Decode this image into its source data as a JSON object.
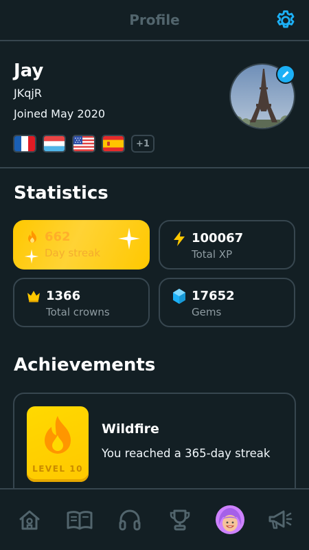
{
  "header": {
    "title": "Profile",
    "settings_icon": "gear-icon",
    "accent": "#1cb0f6"
  },
  "profile": {
    "name": "Jay",
    "username": "JKqjR",
    "joined": "Joined May 2020",
    "flags": [
      "france-flag",
      "luxembourg-flag",
      "usa-flag",
      "spain-flag"
    ],
    "more_courses": "+1",
    "avatar": "eiffel-tower-photo",
    "edit_icon": "pencil-icon"
  },
  "statistics": {
    "title": "Statistics",
    "cards": [
      {
        "icon": "fire-icon",
        "value": "662",
        "label": "Day streak",
        "color": "#ffc800"
      },
      {
        "icon": "lightning-icon",
        "value": "100067",
        "label": "Total XP",
        "color": "#ffc800"
      },
      {
        "icon": "crown-icon",
        "value": "1366",
        "label": "Total crowns",
        "color": "#ffc800"
      },
      {
        "icon": "gem-icon",
        "value": "17652",
        "label": "Gems",
        "color": "#1cb0f6"
      }
    ]
  },
  "achievements": {
    "title": "Achievements",
    "items": [
      {
        "name": "Wildfire",
        "description": "You reached a 365-day streak",
        "badge_level": "LEVEL 10",
        "badge_icon": "fire-icon"
      }
    ]
  },
  "tabbar": {
    "tabs": [
      {
        "icon": "home-icon",
        "active": false
      },
      {
        "icon": "book-icon",
        "active": false
      },
      {
        "icon": "headphones-icon",
        "active": false
      },
      {
        "icon": "trophy-icon",
        "active": false
      },
      {
        "icon": "profile-avatar-icon",
        "active": true
      },
      {
        "icon": "megaphone-icon",
        "active": false
      }
    ]
  }
}
